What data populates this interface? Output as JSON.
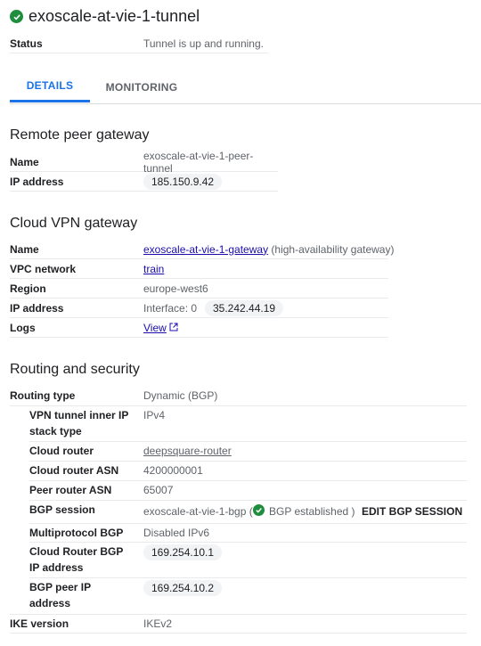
{
  "header": {
    "title": "exoscale-at-vie-1-tunnel",
    "status_label": "Status",
    "status_value": "Tunnel is up and running."
  },
  "tabs": [
    {
      "label": "DETAILS"
    },
    {
      "label": "MONITORING"
    }
  ],
  "remote_peer": {
    "heading": "Remote peer gateway",
    "rows": [
      {
        "label": "Name",
        "value": "exoscale-at-vie-1-peer-tunnel"
      },
      {
        "label": "IP address",
        "value": "185.150.9.42"
      }
    ]
  },
  "vpn_gateway": {
    "heading": "Cloud VPN gateway",
    "name_label": "Name",
    "name_link": "exoscale-at-vie-1-gateway",
    "name_suffix": "(high-availability gateway)",
    "vpc_label": "VPC network",
    "vpc_link": "train",
    "region_label": "Region",
    "region_value": "europe-west6",
    "ip_label": "IP address",
    "ip_interface": "Interface: 0",
    "ip_value": "35.242.44.19",
    "logs_label": "Logs",
    "logs_link": "View"
  },
  "routing": {
    "heading": "Routing and security",
    "routing_type_label": "Routing type",
    "routing_type_value": "Dynamic (BGP)",
    "inner_ip_label": "VPN tunnel inner IP stack type",
    "inner_ip_value": "IPv4",
    "cloud_router_label": "Cloud router",
    "cloud_router_link": "deepsquare-router",
    "asn_label": "Cloud router ASN",
    "asn_value": "4200000001",
    "peer_asn_label": "Peer router ASN",
    "peer_asn_value": "65007",
    "bgp_session_label": "BGP session",
    "bgp_session_value": "exoscale-at-vie-1-bgp (",
    "bgp_status": "BGP established )",
    "edit_bgp": "EDIT BGP SESSION",
    "mp_bgp_label": "Multiprotocol BGP",
    "mp_bgp_value": "Disabled IPv6",
    "cr_bgp_ip_label": "Cloud Router BGP IP address",
    "cr_bgp_ip_value": "169.254.10.1",
    "peer_ip_label": "BGP peer IP address",
    "peer_ip_value": "169.254.10.2",
    "ike_label": "IKE version",
    "ike_value": "IKEv2"
  },
  "colors": {
    "accent": "#1a73e8",
    "success": "#1e8e3e"
  },
  "icons": {
    "status": "check-circle-icon",
    "external": "external-link-icon"
  }
}
